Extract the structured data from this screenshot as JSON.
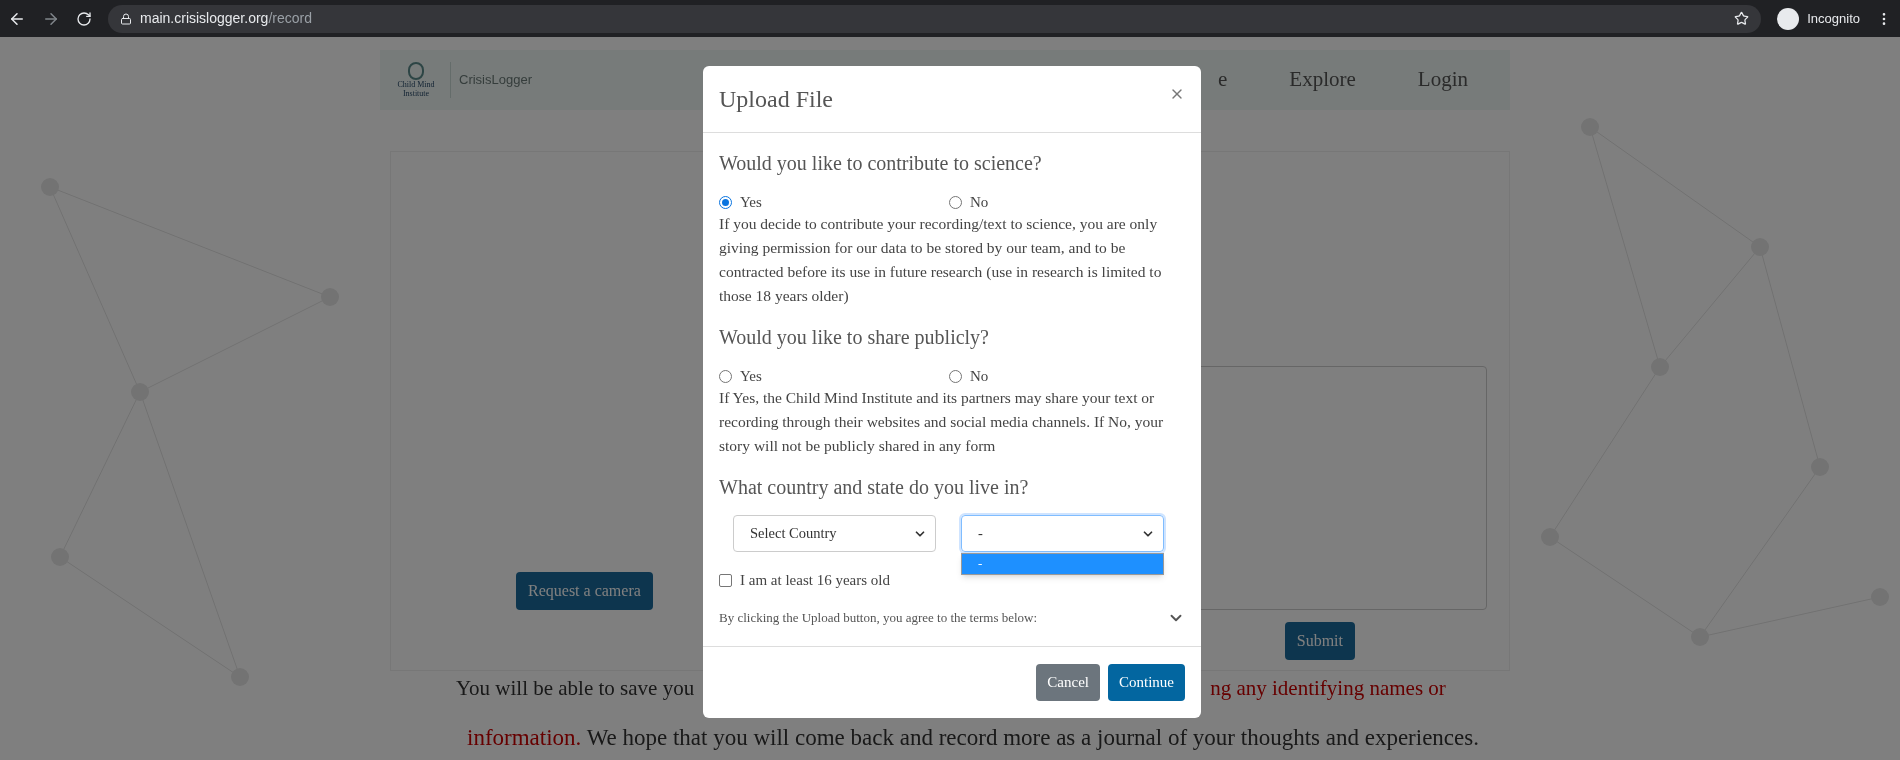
{
  "browser": {
    "url_host": "main.crisislogger.org",
    "url_path": "/record",
    "profile": "Incognito"
  },
  "header": {
    "logo_caption": "Child Mind Institute",
    "logo_text": "CrisisLogger",
    "nav": [
      {
        "label": "e"
      },
      {
        "label": "Explore"
      },
      {
        "label": "Login"
      }
    ]
  },
  "page": {
    "request_button": "Request a camera",
    "submit_button": "Submit",
    "notice_left": "You will be able to save you",
    "notice_right": "ng any identifying names or",
    "notice_line2_red": "information.",
    "notice_line2_rest": "We hope that you will come back and record more as a journal of your thoughts and experiences."
  },
  "modal": {
    "title": "Upload File",
    "sections": [
      {
        "question": "Would you like to contribute to science?",
        "options": [
          {
            "label": "Yes",
            "selected": true
          },
          {
            "label": "No",
            "selected": false
          }
        ],
        "note": "If you decide to contribute your recording/text to science, you are only giving permission for our data to be stored by our team, and to be contracted before its use in future research (use in research is limited to those 18 years older)"
      },
      {
        "question": "Would you like to share publicly?",
        "options": [
          {
            "label": "Yes",
            "selected": false
          },
          {
            "label": "No",
            "selected": false
          }
        ],
        "note": "If Yes, the Child Mind Institute and its partners may share your text or recording through their websites and social media channels. If No, your story will not be publicly shared in any form"
      }
    ],
    "location": {
      "question": "What country and state do you live in?",
      "country": {
        "value": "Select Country"
      },
      "state": {
        "value": "-",
        "open": true,
        "options": [
          {
            "label": "-",
            "selected": true
          }
        ]
      }
    },
    "age_check": {
      "label": "I am at least 16 years old",
      "checked": false
    },
    "terms": {
      "text": "By clicking the Upload button, you agree to the terms below:",
      "expanded": false
    },
    "buttons": [
      {
        "label": "Cancel",
        "kind": "secondary"
      },
      {
        "label": "Continue",
        "kind": "primary"
      }
    ]
  }
}
